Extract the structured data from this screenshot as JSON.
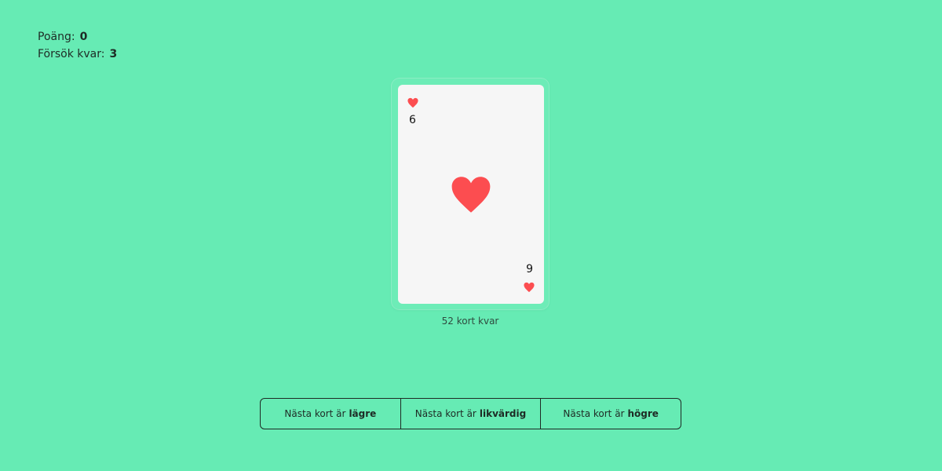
{
  "scoreboard": {
    "score_label": "Poäng:",
    "score_value": "0",
    "attempts_label": "Försök kvar:",
    "attempts_value": "3"
  },
  "card": {
    "suit": "hearts",
    "suit_icon": "heart-icon",
    "suit_color": "#fc4d50",
    "top_left_rank": "6",
    "bottom_right_rank": "9"
  },
  "deck": {
    "remaining_text": "52 kort kvar"
  },
  "guess_buttons": [
    {
      "prefix": "Nästa kort är",
      "keyword": "lägre"
    },
    {
      "prefix": "Nästa kort är",
      "keyword": "likvärdig"
    },
    {
      "prefix": "Nästa kort är",
      "keyword": "högre"
    }
  ],
  "colors": {
    "background": "#66ebb4",
    "card_face": "#f6f6f6",
    "text": "#1e2b25"
  }
}
